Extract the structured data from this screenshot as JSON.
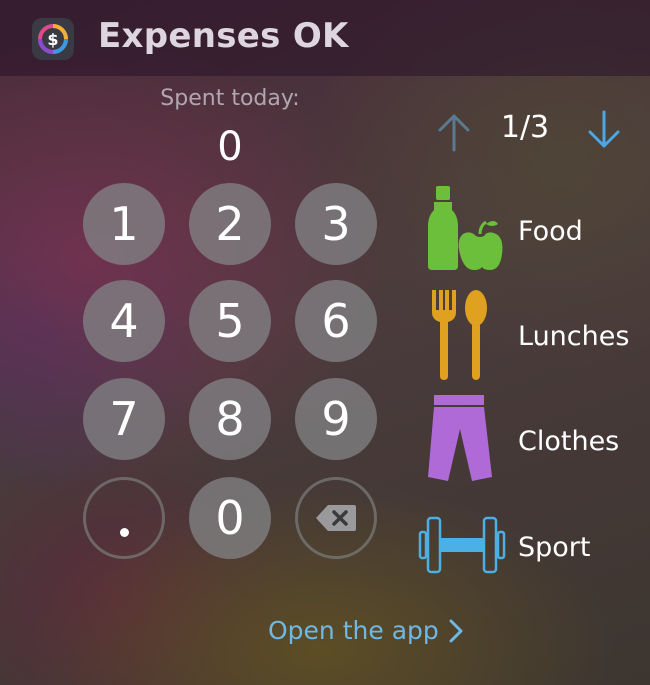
{
  "header": {
    "app_icon": "dollar-circle-icon",
    "title": "Expenses OK"
  },
  "spent": {
    "label": "Spent today:",
    "value": "0"
  },
  "keypad": {
    "keys": [
      "1",
      "2",
      "3",
      "4",
      "5",
      "6",
      "7",
      "8",
      "9",
      ".",
      "0",
      "backspace"
    ],
    "k1": "1",
    "k2": "2",
    "k3": "3",
    "k4": "4",
    "k5": "5",
    "k6": "6",
    "k7": "7",
    "k8": "8",
    "k9": "9",
    "k0": "0",
    "backspace_icon": "backspace-icon"
  },
  "pager": {
    "text": "1/3",
    "up_icon": "arrow-up-icon",
    "down_icon": "arrow-down-icon"
  },
  "categories": [
    {
      "label": "Food",
      "icon": "bottle-apple-icon",
      "color": "#6cbf3a"
    },
    {
      "label": "Lunches",
      "icon": "fork-spoon-icon",
      "color": "#e0a020"
    },
    {
      "label": "Clothes",
      "icon": "trousers-icon",
      "color": "#b06ad8"
    },
    {
      "label": "Sport",
      "icon": "dumbbell-icon",
      "color": "#4ab0e6"
    }
  ],
  "footer": {
    "open_app": "Open the app"
  },
  "colors": {
    "accent_blue": "#6fb8e6",
    "key_fill": "#828284"
  }
}
